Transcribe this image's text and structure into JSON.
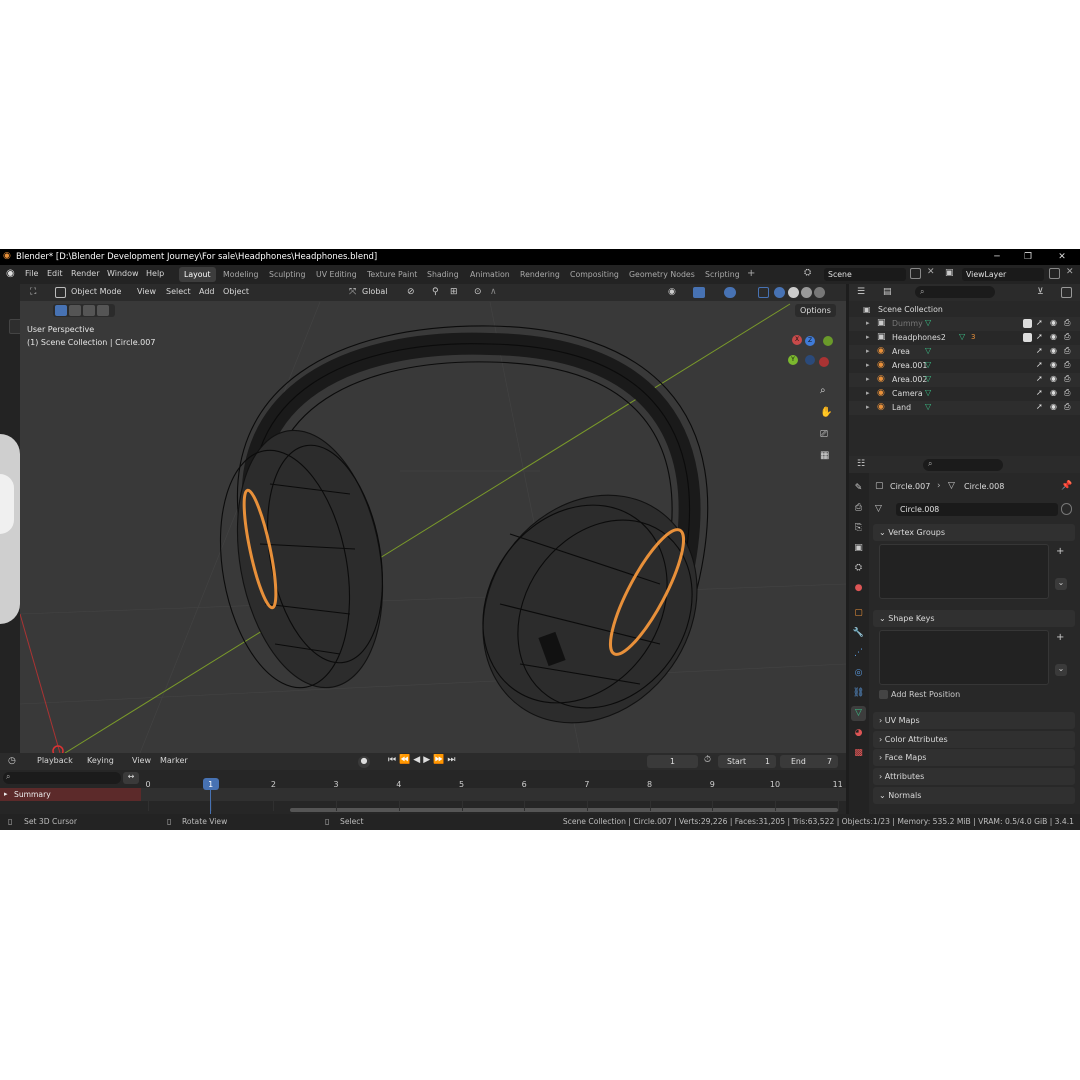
{
  "window": {
    "title": "Blender* [D:\\Blender Development Journey\\For sale\\Headphones\\Headphones.blend]",
    "minimize": "─",
    "maximize": "❐",
    "close": "✕"
  },
  "menu": {
    "items": [
      "File",
      "Edit",
      "Render",
      "Window",
      "Help"
    ]
  },
  "workspaces": {
    "tabs": [
      "Layout",
      "Modeling",
      "Sculpting",
      "UV Editing",
      "Texture Paint",
      "Shading",
      "Animation",
      "Rendering",
      "Compositing",
      "Geometry Nodes",
      "Scripting"
    ],
    "active": "Layout",
    "add": "+"
  },
  "scene": {
    "name": "Scene",
    "view_layer": "ViewLayer"
  },
  "viewport": {
    "mode": "Object Mode",
    "menus": [
      "View",
      "Select",
      "Add",
      "Object"
    ],
    "orientation": "Global",
    "options": "Options",
    "perspective": "User Perspective",
    "context": "(1) Scene Collection | Circle.007",
    "gizmo": {
      "x": "X",
      "y": "Y",
      "z": "Z"
    }
  },
  "outliner": {
    "root": "Scene Collection",
    "items": [
      {
        "name": "Dummy",
        "dim": true,
        "badge": "",
        "visible": true
      },
      {
        "name": "Headphones2",
        "dim": false,
        "badge": "3",
        "visible": true
      },
      {
        "name": "Area",
        "dim": false,
        "badge": "",
        "visible": true
      },
      {
        "name": "Area.001",
        "dim": false,
        "badge": "",
        "visible": true
      },
      {
        "name": "Area.002",
        "dim": false,
        "badge": "",
        "visible": true
      },
      {
        "name": "Camera",
        "dim": false,
        "badge": "",
        "visible": true
      },
      {
        "name": "Land",
        "dim": false,
        "badge": "",
        "visible": true
      }
    ]
  },
  "properties": {
    "object": "Circle.007",
    "mesh": "Circle.008",
    "datablock": "Circle.008",
    "panels": {
      "vertex_groups": "Vertex Groups",
      "shape_keys": "Shape Keys",
      "add_rest_position": "Add Rest Position",
      "uv_maps": "UV Maps",
      "color_attributes": "Color Attributes",
      "face_maps": "Face Maps",
      "attributes": "Attributes",
      "normals": "Normals"
    }
  },
  "timeline": {
    "menus": [
      "Playback",
      "Keying",
      "View",
      "Marker"
    ],
    "current_frame": "1",
    "start_label": "Start",
    "start": "1",
    "end_label": "End",
    "end": "7",
    "ticks": [
      "0",
      "1",
      "2",
      "3",
      "4",
      "5",
      "6",
      "7",
      "8",
      "9",
      "10",
      "11"
    ],
    "summary": "Summary"
  },
  "status": {
    "left1": "Set 3D Cursor",
    "left2": "Rotate View",
    "left3": "Select",
    "right": "Scene Collection | Circle.007 | Verts:29,226 | Faces:31,205 | Tris:63,522 | Objects:1/23 | Memory: 535.2 MiB | VRAM: 0.5/4.0 GiB | 3.4.1"
  },
  "colors": {
    "accent": "#4772b3",
    "selection": "#e8903a",
    "bg": "#393939",
    "wire": "#0b0b0b"
  }
}
